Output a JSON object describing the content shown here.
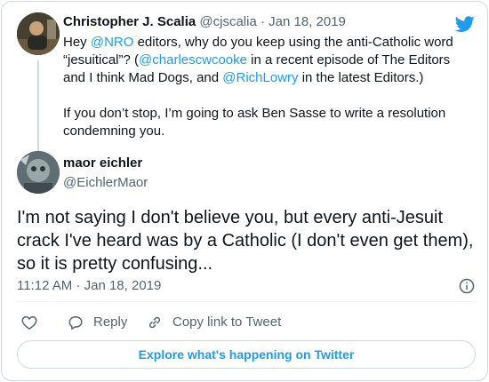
{
  "parent_tweet": {
    "author_name": "Christopher J. Scalia",
    "handle": "@cjscalia",
    "separator": "·",
    "date": "Jan 18, 2019",
    "body_line1_parts": [
      {
        "t": "Hey ",
        "m": false
      },
      {
        "t": "@NRO",
        "m": true
      },
      {
        "t": " editors, why do you keep using the anti-Catholic word “jesuitical”? (",
        "m": false
      },
      {
        "t": "@charlescwcooke",
        "m": true
      },
      {
        "t": " in a recent episode of The Editors and I think Mad Dogs, and ",
        "m": false
      },
      {
        "t": "@RichLowry",
        "m": true
      },
      {
        "t": " in the latest Editors.)",
        "m": false
      }
    ],
    "body_para2": "If you don’t stop, I’m going to ask Ben Sasse to write a resolution condemning you."
  },
  "main_tweet": {
    "author_name": "maor eichler",
    "handle": "@EichlerMaor",
    "body": "I'm not saying I don't believe you, but every anti-Jesuit crack I've heard was by a Catholic (I don't even get them), so it is pretty confusing...",
    "time": "11:12 AM",
    "separator": "·",
    "date": "Jan 18, 2019"
  },
  "actions": {
    "reply_label": "Reply",
    "copy_link_label": "Copy link to Tweet"
  },
  "explore_label": "Explore what's happening on Twitter",
  "icons": {
    "brand": "twitter-bird-icon",
    "info": "info-icon",
    "like": "heart-icon",
    "reply": "reply-bubble-icon",
    "copy": "link-icon"
  },
  "colors": {
    "accent": "#1d9bf0",
    "text": "#0f1419",
    "muted": "#536471",
    "border": "#cfd9de"
  }
}
